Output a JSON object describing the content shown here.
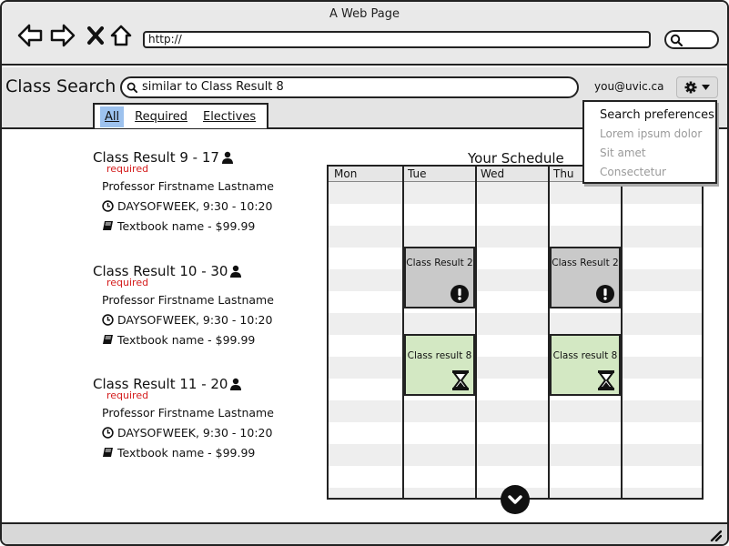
{
  "window": {
    "title": "A Web Page",
    "url": "http://"
  },
  "header": {
    "app_title": "Class Search",
    "search_value": "similar to Class Result 8",
    "user_email": "you@uvic.ca"
  },
  "tabs": [
    {
      "label": "All",
      "active": true
    },
    {
      "label": "Required",
      "active": false
    },
    {
      "label": "Electives",
      "active": false
    }
  ],
  "settings_menu": {
    "items": [
      {
        "label": "Search preferences",
        "enabled": true
      },
      {
        "label": "Lorem ipsum dolor",
        "enabled": false
      },
      {
        "label": "Sit amet",
        "enabled": false
      },
      {
        "label": "Consectetur",
        "enabled": false
      }
    ]
  },
  "results": [
    {
      "title": "Class Result 9 - 17",
      "tag": "required",
      "professor": "Professor Firstname Lastname",
      "time": "DAYSOFWEEK, 9:30 - 10:20",
      "textbook": "Textbook name - $99.99"
    },
    {
      "title": "Class Result 10 - 30",
      "tag": "required",
      "professor": "Professor Firstname Lastname",
      "time": "DAYSOFWEEK, 9:30 - 10:20",
      "textbook": "Textbook name - $99.99"
    },
    {
      "title": "Class Result 11 - 20",
      "tag": "required",
      "professor": "Professor Firstname Lastname",
      "time": "DAYSOFWEEK, 9:30 - 10:20",
      "textbook": "Textbook name - $99.99"
    }
  ],
  "schedule": {
    "title": "Your Schedule",
    "days": [
      "Mon",
      "Tue",
      "Wed",
      "Thu"
    ],
    "events": [
      {
        "label": "Class Result 2",
        "day": "Tue",
        "status": "conflict",
        "color": "#c9c9c9"
      },
      {
        "label": "Class Result 2",
        "day": "Thu",
        "status": "conflict",
        "color": "#c9c9c9"
      },
      {
        "label": "Class result 8",
        "day": "Tue",
        "status": "pending",
        "color": "#d3e8c3"
      },
      {
        "label": "Class result 8",
        "day": "Thu",
        "status": "pending",
        "color": "#d3e8c3"
      }
    ]
  },
  "colors": {
    "active_tab": "#9dc2ee",
    "required": "#d41c1c",
    "conflict_event": "#c9c9c9",
    "pending_event": "#d3e8c3",
    "disabled_menu": "#9a9a9a"
  }
}
